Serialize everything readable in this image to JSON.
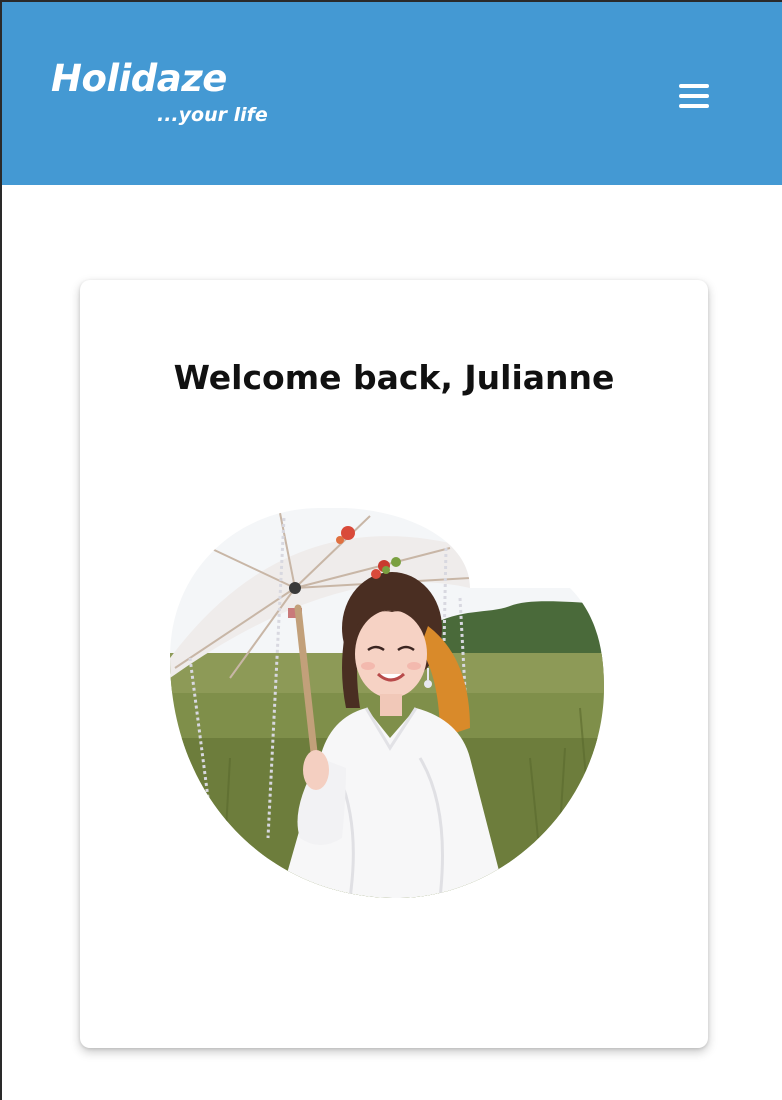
{
  "header": {
    "brand_title": "Holidaze",
    "brand_tagline": "...your life",
    "menu_icon": "hamburger-menu-icon"
  },
  "main": {
    "welcome_heading": "Welcome back, Julianne"
  },
  "colors": {
    "accent": "#4499d3",
    "page_background": "#ffffff",
    "card_background": "#ffffff",
    "heading_text": "#111111"
  }
}
